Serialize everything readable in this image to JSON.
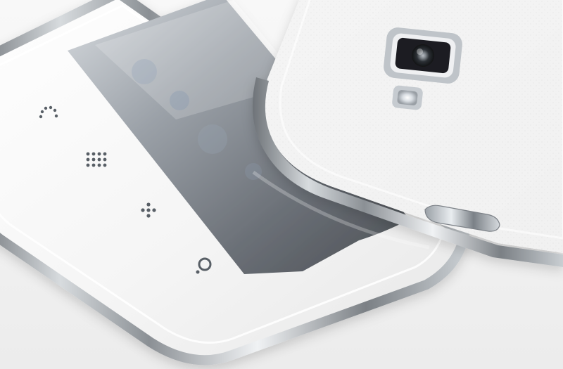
{
  "scene": {
    "subject": "two-white-smartphones",
    "background_color": "#f3f3f3",
    "front_phone": {
      "body_color": "#f7f7f7",
      "screen_color": "#6f7378",
      "chrome_color": "#c9cdd2",
      "nav_keys": [
        "back-key",
        "menu-grid-key",
        "home-dots-key",
        "search-key"
      ]
    },
    "rear_phone": {
      "body_color": "#f1f1f1",
      "chrome_color": "#8f9499",
      "camera": "camera-lens",
      "flash": "led-flash",
      "side_button": "side-button"
    }
  }
}
